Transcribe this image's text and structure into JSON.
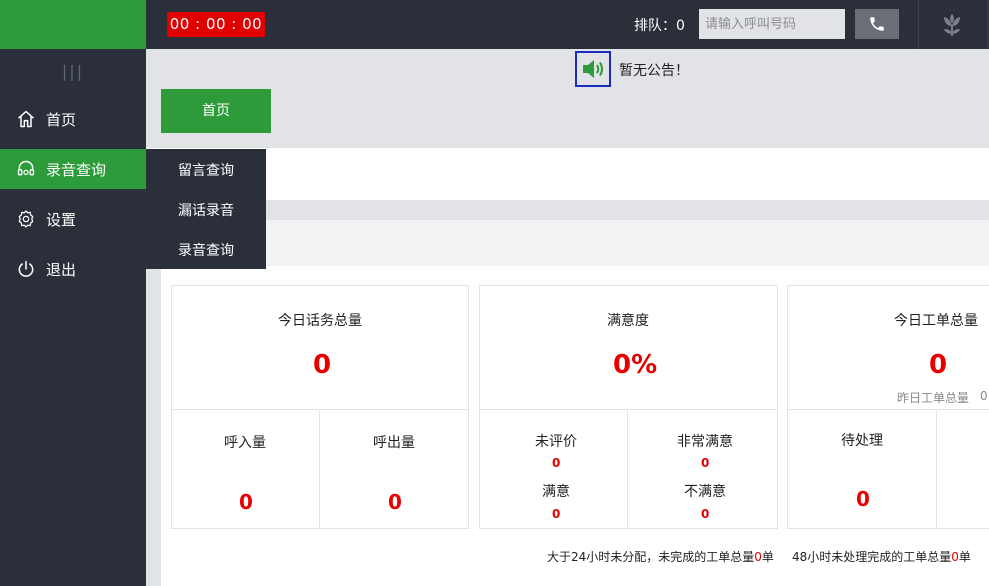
{
  "topbar": {
    "timer": "00 : 00 : 00",
    "queue_text": "排队：0",
    "call_placeholder": "请输入呼叫号码"
  },
  "sidebar": {
    "collapse_glyph": "|||",
    "items": [
      {
        "label": "首页",
        "icon": "home-icon",
        "active": false
      },
      {
        "label": "录音查询",
        "icon": "headset-icon",
        "active": true
      },
      {
        "label": "设置",
        "icon": "gear-icon",
        "active": false
      },
      {
        "label": "退出",
        "icon": "power-icon",
        "active": false
      }
    ]
  },
  "notice": {
    "text": "暂无公告！"
  },
  "tabs": {
    "home_label": "首页"
  },
  "submenu": {
    "items": [
      "留言查询",
      "漏话录音",
      "录音查询"
    ]
  },
  "cards": {
    "calls": {
      "title": "今日话务总量",
      "total": "0",
      "in_label": "呼入量",
      "in_value": "0",
      "out_label": "呼出量",
      "out_value": "0"
    },
    "satisfaction": {
      "title": "满意度",
      "total": "0%",
      "unrated_label": "未评价",
      "unrated_value": "0",
      "very_label": "非常满意",
      "very_value": "0",
      "satisfied_label": "满意",
      "satisfied_value": "0",
      "unsatisfied_label": "不满意",
      "unsatisfied_value": "0"
    },
    "orders": {
      "title": "今日工单总量",
      "total": "0",
      "yesterday_label": "昨日工单总量",
      "yesterday_value": "0",
      "pending_label": "待处理",
      "pending_value": "0"
    }
  },
  "footer": {
    "stat1_prefix": "大于24小时未分配，未完成的工单总量",
    "stat1_value": "0",
    "stat1_suffix": "单",
    "stat2_prefix": "48小时未处理完成的工单总量",
    "stat2_value": "0",
    "stat2_suffix": "单"
  },
  "colors": {
    "accent_green": "#2e9b3a",
    "sidebar_dark": "#2b2f3a",
    "alert_red": "#e00000"
  }
}
